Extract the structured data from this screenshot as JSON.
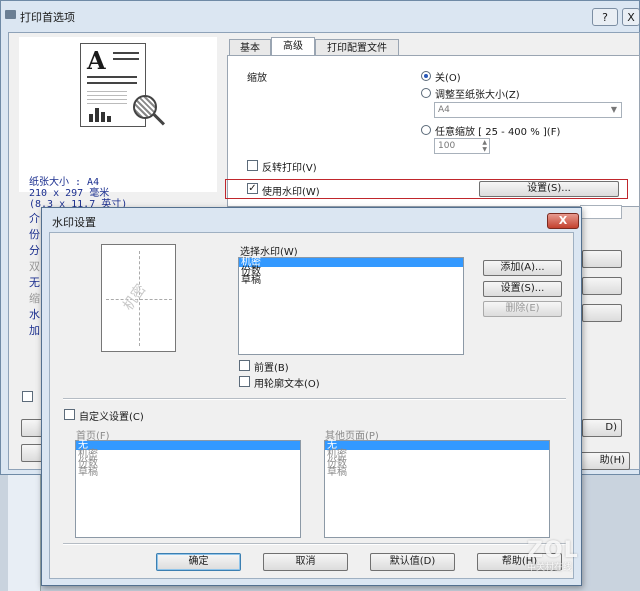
{
  "outer_window": {
    "title": "打印首选项",
    "help_button": "?",
    "close_button": "X"
  },
  "doc_icon_letter": "A",
  "paper_info": [
    "纸张大小 : A4",
    "210 x 297 毫米",
    "(8.3 x 11.7 英寸)"
  ],
  "left_partial_lines": [
    "介",
    "份",
    "分",
    "双",
    "无",
    "缩",
    "水",
    "加"
  ],
  "tabs": [
    "基本",
    "高级",
    "打印配置文件"
  ],
  "scaling": {
    "label": "缩放",
    "off": "关(O)",
    "fit_to_paper": "调整至纸张大小(Z)",
    "paper_select": "A4",
    "free_scale": "任意缩放  [ 25 - 400 % ](F)",
    "scale_value": "100"
  },
  "reverse_print": "反转打印(V)",
  "use_watermark": "使用水印(W)",
  "watermark_settings_button": "设置(S)...",
  "outer_right_partial": [
    "D)",
    "助(H)"
  ],
  "dialog": {
    "title": "水印设置",
    "close": "X",
    "preview_text": "机密",
    "select_label": "选择水印(W)",
    "watermarks": [
      "机密",
      "份数",
      "草稿"
    ],
    "add_button": "添加(A)...",
    "settings_button": "设置(S)...",
    "delete_button": "删除(E)",
    "front": "前置(B)",
    "outline_text": "用轮廓文本(O)",
    "custom_settings": "自定义设置(C)",
    "first_page_label": "首页(F)",
    "first_page_items": [
      "无",
      "机密",
      "份数",
      "草稿"
    ],
    "other_pages_label": "其他页面(P)",
    "other_pages_items": [
      "无",
      "机密",
      "份数",
      "草稿"
    ],
    "ok": "确定",
    "cancel": "取消",
    "default": "默认值(D)",
    "help": "帮助(H)"
  },
  "watermark_logo": {
    "brand": "ZOL",
    "sub": "中关村在线"
  },
  "colors": {
    "highlight_border": "#c0262c",
    "selection": "#3399ff",
    "info_text": "#1b2f8f"
  }
}
